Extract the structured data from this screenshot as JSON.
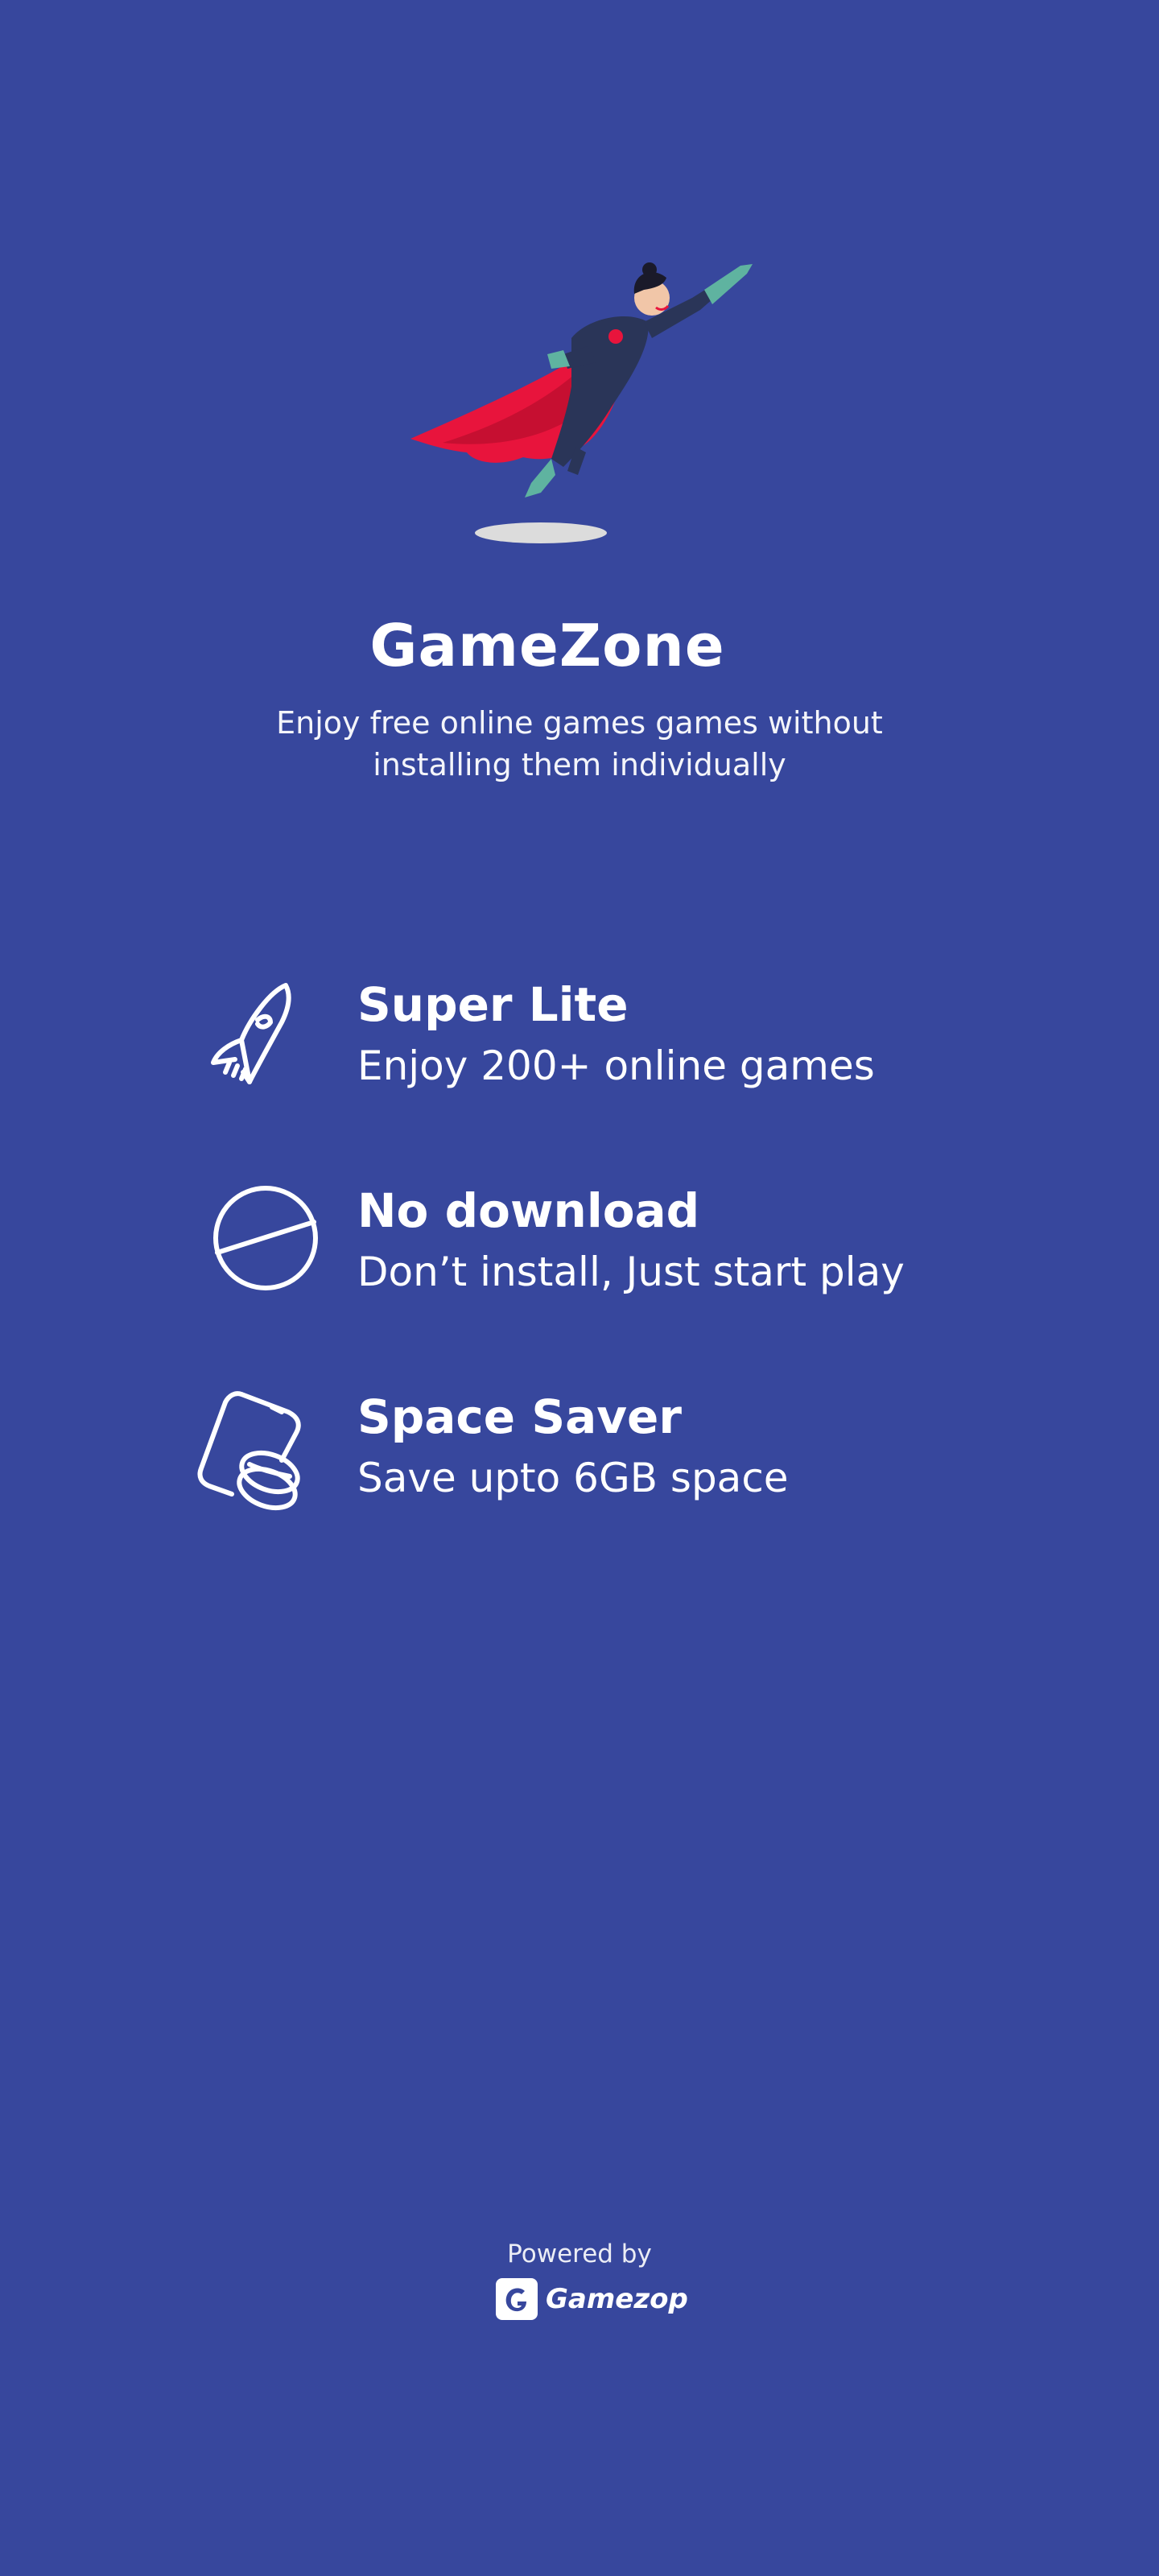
{
  "app": {
    "title": "GameZone",
    "subtitle": "Enjoy free online games games without installing them individually"
  },
  "hero": {
    "illustration": "flying-superhero-icon"
  },
  "features": [
    {
      "icon": "rocket-icon",
      "title": "Super Lite",
      "description": "Enjoy 200+ online games"
    },
    {
      "icon": "no-download-icon",
      "title": "No download",
      "description": "Don’t install, Just start play"
    },
    {
      "icon": "phone-storage-icon",
      "title": "Space Saver",
      "description": "Save upto 6GB space"
    }
  ],
  "footer": {
    "powered_by": "Powered by",
    "brand_name": "Gamezop",
    "brand_icon": "gamezop-logo-icon"
  },
  "colors": {
    "background": "#37479d",
    "text": "#ffffff",
    "cape": "#e8143c",
    "suit": "#2a3558",
    "gloves": "#5fb3a0"
  }
}
